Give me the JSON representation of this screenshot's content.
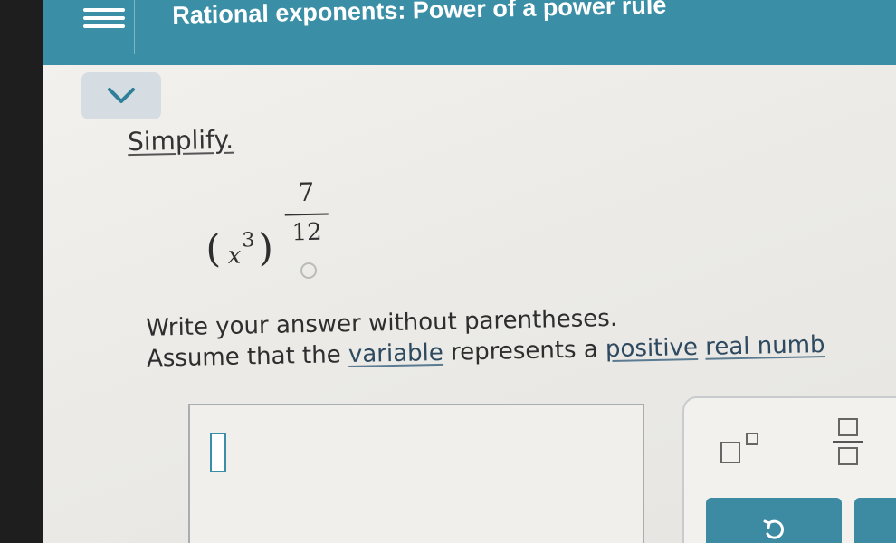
{
  "header": {
    "title": "Rational exponents: Power of a power rule"
  },
  "icons": {
    "menu": "menu-icon",
    "collapse": "chevron-down-icon",
    "exponent_template": "exponent-template-icon",
    "fraction_template": "fraction-template-icon",
    "undo": "undo-icon"
  },
  "problem": {
    "prompt": "Simplify.",
    "expression": {
      "base": "x",
      "inner_exponent": "3",
      "outer_numerator": "7",
      "outer_denominator": "12"
    },
    "instruction_line1": "Write your answer without parentheses.",
    "instruction_line2_pre": "Assume that the ",
    "instruction_link_variable": "variable",
    "instruction_line2_mid": " represents a ",
    "instruction_link_positive": "positive",
    "instruction_link_real_number": "real numb"
  },
  "answer": {
    "value": ""
  },
  "colors": {
    "header": "#3a8fa6",
    "button": "#3d8ba3",
    "background": "#eeede9"
  }
}
